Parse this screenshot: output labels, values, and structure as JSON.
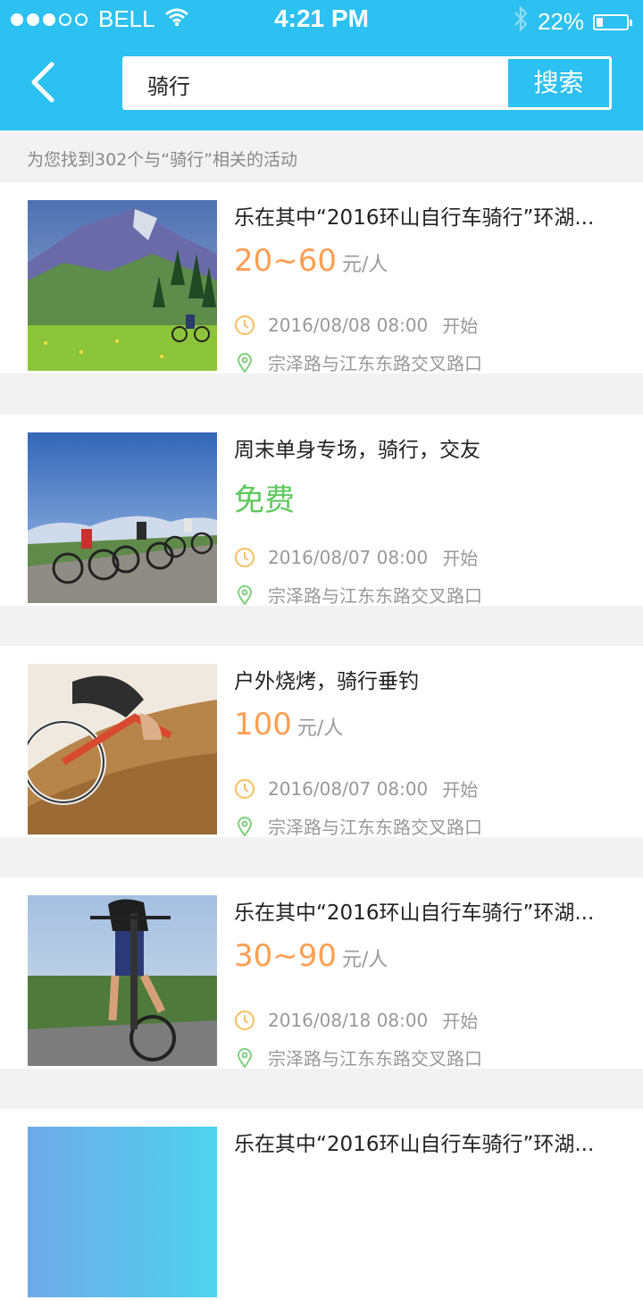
{
  "status_bar": {
    "carrier": "BELL",
    "time": "4:21 PM",
    "battery_percent": "22%",
    "battery_level": 0.22,
    "signal_dots_filled": 3,
    "signal_dots_total": 5
  },
  "header": {
    "search_value": "骑行",
    "search_button": "搜索",
    "accent_color": "#2cc1f0"
  },
  "result_summary": "为您找到302个与“骑行”相关的活动",
  "activities": [
    {
      "title": "乐在其中“2016环山自行车骑行”环湖...",
      "price": "20~60",
      "unit": "元/人",
      "time": "2016/08/08 08:00",
      "start_label": "开始",
      "address": "宗泽路与江东东路交叉路口"
    },
    {
      "title": "周末单身专场，骑行，交友",
      "price": "免费",
      "unit": "",
      "time": "2016/08/07 08:00",
      "start_label": "开始",
      "address": "宗泽路与江东东路交叉路口"
    },
    {
      "title": "户外烧烤，骑行垂钓",
      "price": "100",
      "unit": "元/人",
      "time": "2016/08/07 08:00",
      "start_label": "开始",
      "address": "宗泽路与江东东路交叉路口"
    },
    {
      "title": "乐在其中“2016环山自行车骑行”环湖...",
      "price": "30~90",
      "unit": "元/人",
      "time": "2016/08/18 08:00",
      "start_label": "开始",
      "address": "宗泽路与江东东路交叉路口"
    },
    {
      "title": "乐在其中“2016环山自行车骑行”环湖..."
    }
  ],
  "icons": {
    "back": "chevron-left-icon",
    "clock": "clock-icon",
    "location": "location-pin-icon",
    "wifi": "wifi-icon",
    "bluetooth": "bluetooth-icon"
  }
}
